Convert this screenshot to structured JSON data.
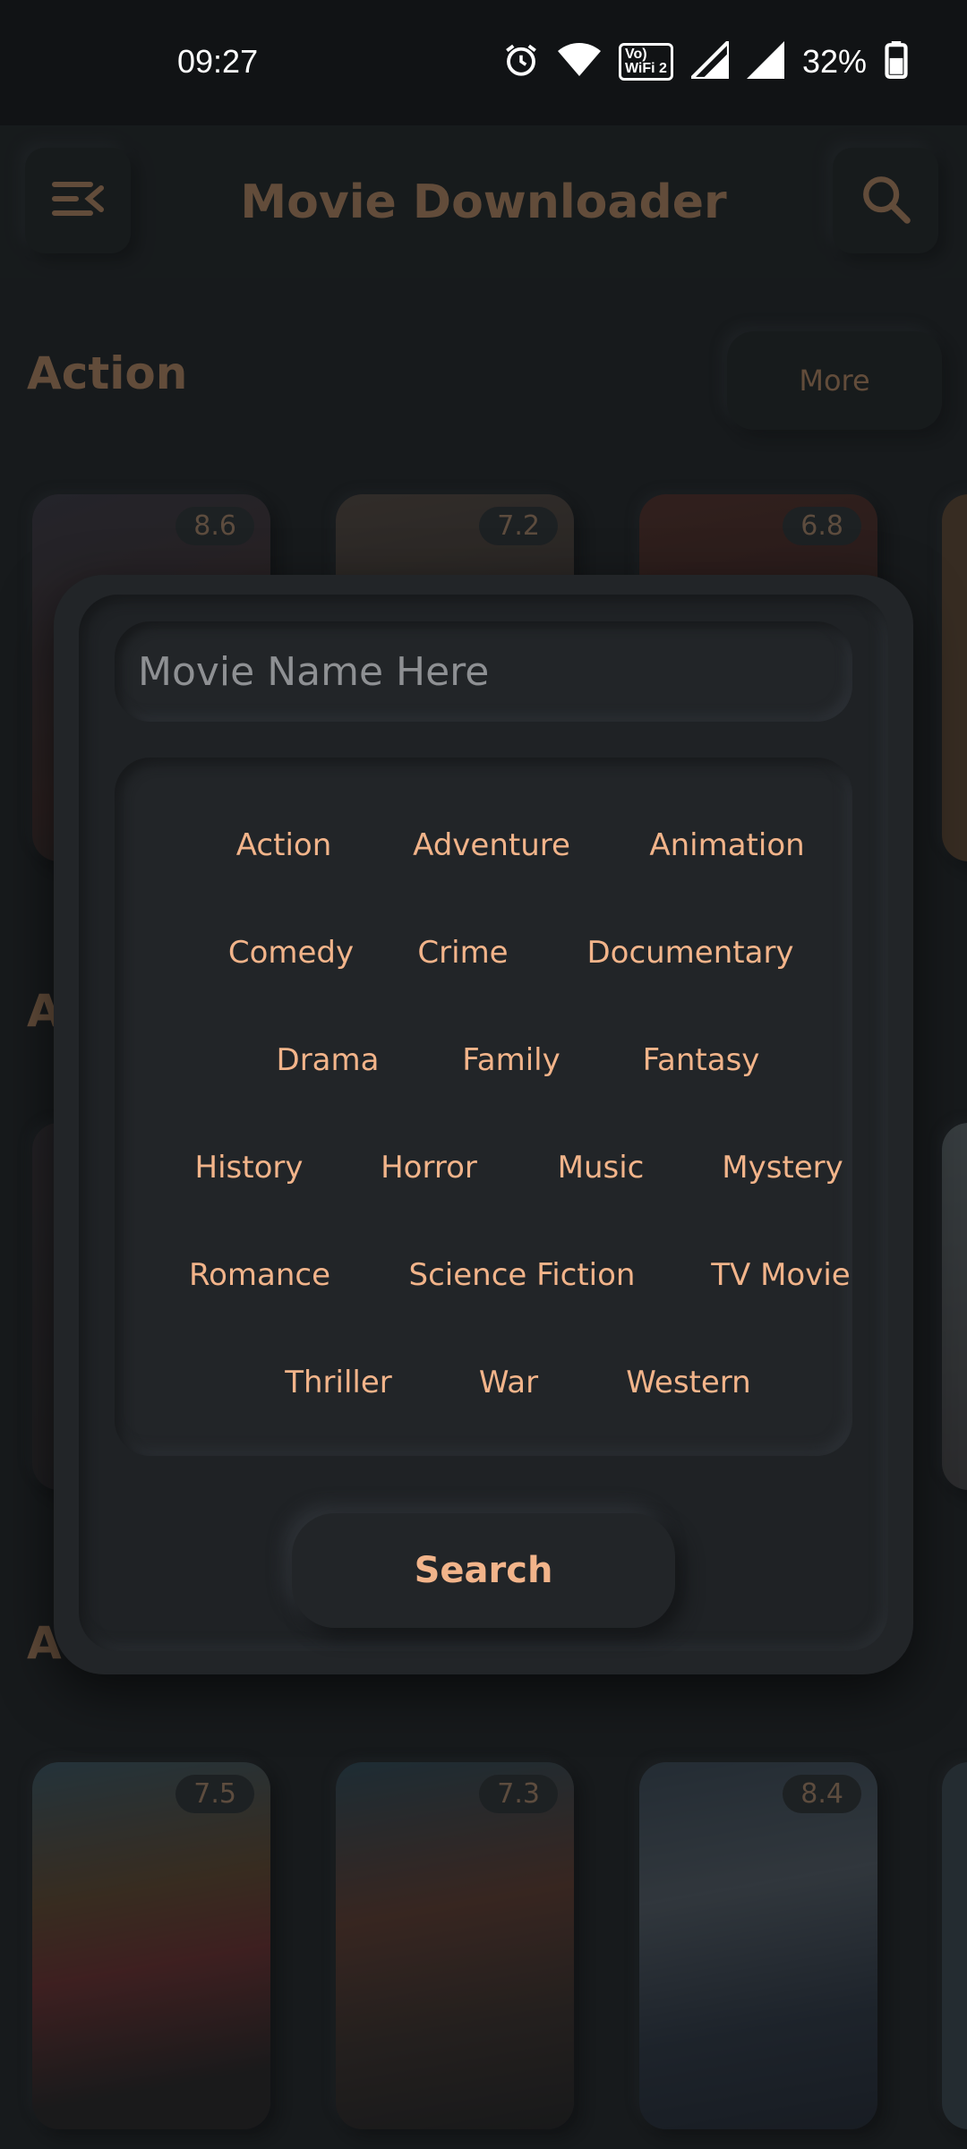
{
  "status_bar": {
    "time": "09:27",
    "battery": "32%",
    "wifi_badge_top": "Vo)",
    "wifi_badge_bottom": "WiFi 2",
    "icons": [
      "alarm-icon",
      "wifi-icon",
      "wifi-calling-icon",
      "signal-icon",
      "signal-icon",
      "battery-icon"
    ]
  },
  "app_bar": {
    "title": "Movie Downloader",
    "menu_icon": "menu-collapse-icon",
    "search_icon": "search-icon"
  },
  "sections": [
    {
      "title": "Action",
      "more_label": "More",
      "ratings": [
        "8.6",
        "7.2",
        "6.8"
      ]
    },
    {
      "title": "A",
      "ratings": []
    },
    {
      "title": "A",
      "ratings": [
        "7.5",
        "7.3",
        "8.4"
      ]
    }
  ],
  "dialog": {
    "search_placeholder": "Movie Name Here",
    "genres": [
      "Action",
      "Adventure",
      "Animation",
      "Comedy",
      "Crime",
      "Documentary",
      "Drama",
      "Family",
      "Fantasy",
      "History",
      "Horror",
      "Music",
      "Mystery",
      "Romance",
      "Science Fiction",
      "TV Movie",
      "Thriller",
      "War",
      "Western"
    ],
    "search_button": "Search"
  },
  "colors": {
    "accent": "#f2b48a",
    "background": "#171a1c",
    "dialog": "#222528"
  }
}
